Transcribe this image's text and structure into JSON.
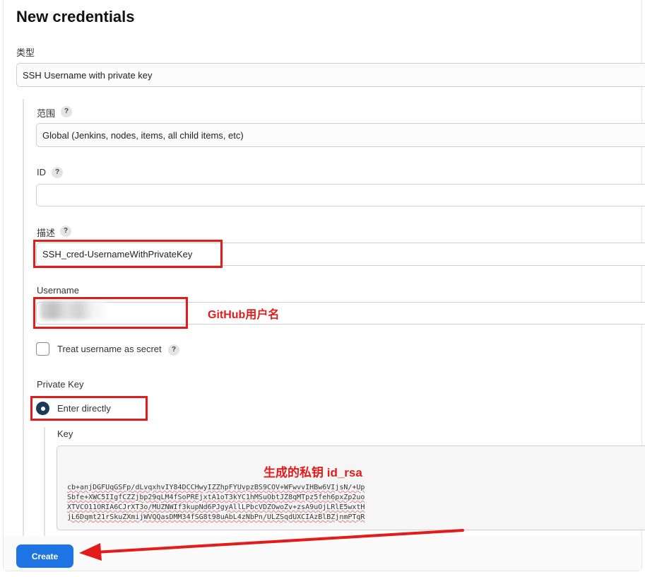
{
  "page": {
    "title": "New credentials"
  },
  "kind": {
    "label": "类型",
    "value": "SSH Username with private key"
  },
  "scope": {
    "label": "范围",
    "help": "?",
    "value": "Global (Jenkins, nodes, items, all child items, etc)"
  },
  "id_field": {
    "label": "ID",
    "help": "?",
    "value": ""
  },
  "description": {
    "label": "描述",
    "help": "?",
    "value": "SSH_cred-UsernameWithPrivateKey"
  },
  "username": {
    "label": "Username"
  },
  "secret_toggle": {
    "label": "Treat username as secret",
    "help": "?",
    "checked": false
  },
  "private_key": {
    "label": "Private Key",
    "option_label": "Enter directly",
    "key_label": "Key",
    "key_lines": [
      "cb+anjDGFUqGSFp/dLvqxhvIY84DCCHwyIZZhpFYUvpzBS9COV+WFwvvIHBw6VIjsN/+Up",
      "Sbfe+XWC5IIgfCZZjbp29qLM4fSoPREjxtA1oT3kYC1hMSuObtJZ8qMTpz5feh6pxZp2uo",
      "XTVCO11ORIA6CJrXT3o/MUZNWIf3kupNd6PJgyAllLPbcVDZOwoZv+zsA9uOjLRlE5wxtH",
      "jL6Dqmt21rSkuZXmijWVQQasDMM34fSG8t98uAbL4zNbPn/ULZSqdUXCIAzBlBZjnmPTqR"
    ]
  },
  "annotations": {
    "username_note": "GitHub用户名",
    "key_note": "生成的私钥 id_rsa"
  },
  "actions": {
    "create_label": "Create"
  },
  "colors": {
    "accent": "#1e74e3",
    "annotation": "#e31b1b",
    "radio": "#1b3a57"
  }
}
